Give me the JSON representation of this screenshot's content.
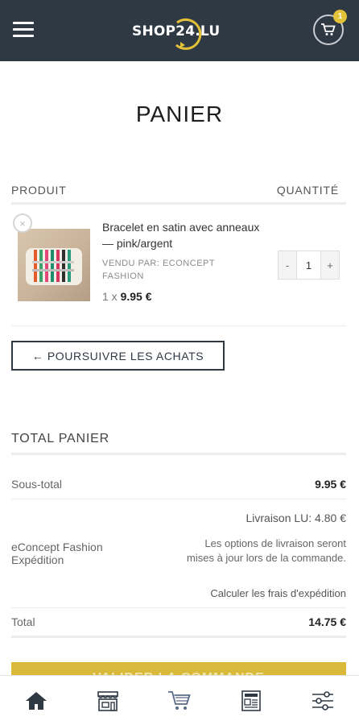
{
  "header": {
    "logo_text": "SHOP24.LU",
    "cart_count": "1",
    "accent_color": "#e3c237",
    "bar_color": "#2f3944"
  },
  "page": {
    "title": "PANIER"
  },
  "cart_table": {
    "col_product": "PRODUIT",
    "col_quantity": "QUANTITÉ",
    "items": [
      {
        "remove_icon": "×",
        "name": "Bracelet en satin avec anneaux — pink/argent",
        "vendor": "VENDU PAR: ECONCEPT FASHION",
        "qty_prefix": "1 x",
        "price": "9.95 €",
        "quantity": "1",
        "minus": "-",
        "plus": "+"
      }
    ]
  },
  "continue_button": "← POURSUIVRE LES ACHATS",
  "totals": {
    "title": "TOTAL PANIER",
    "subtotal_label": "Sous-total",
    "subtotal_value": "9.95 €",
    "shipping_label": "eConcept Fashion Expédition",
    "shipping_rate": "Livraison LU: 4.80 €",
    "shipping_note": "Les options de livraison seront mises à jour lors de la commande.",
    "shipping_calc": "Calculer les frais d'expédition",
    "total_label": "Total",
    "total_value": "14.75 €"
  },
  "checkout_button": "VALIDER LA COMMANDE",
  "bottom_nav": [
    {
      "icon": "home-icon",
      "active": true
    },
    {
      "icon": "store-icon",
      "active": false
    },
    {
      "icon": "cart-icon",
      "active": false
    },
    {
      "icon": "news-icon",
      "active": false
    },
    {
      "icon": "settings-sliders-icon",
      "active": false
    }
  ]
}
